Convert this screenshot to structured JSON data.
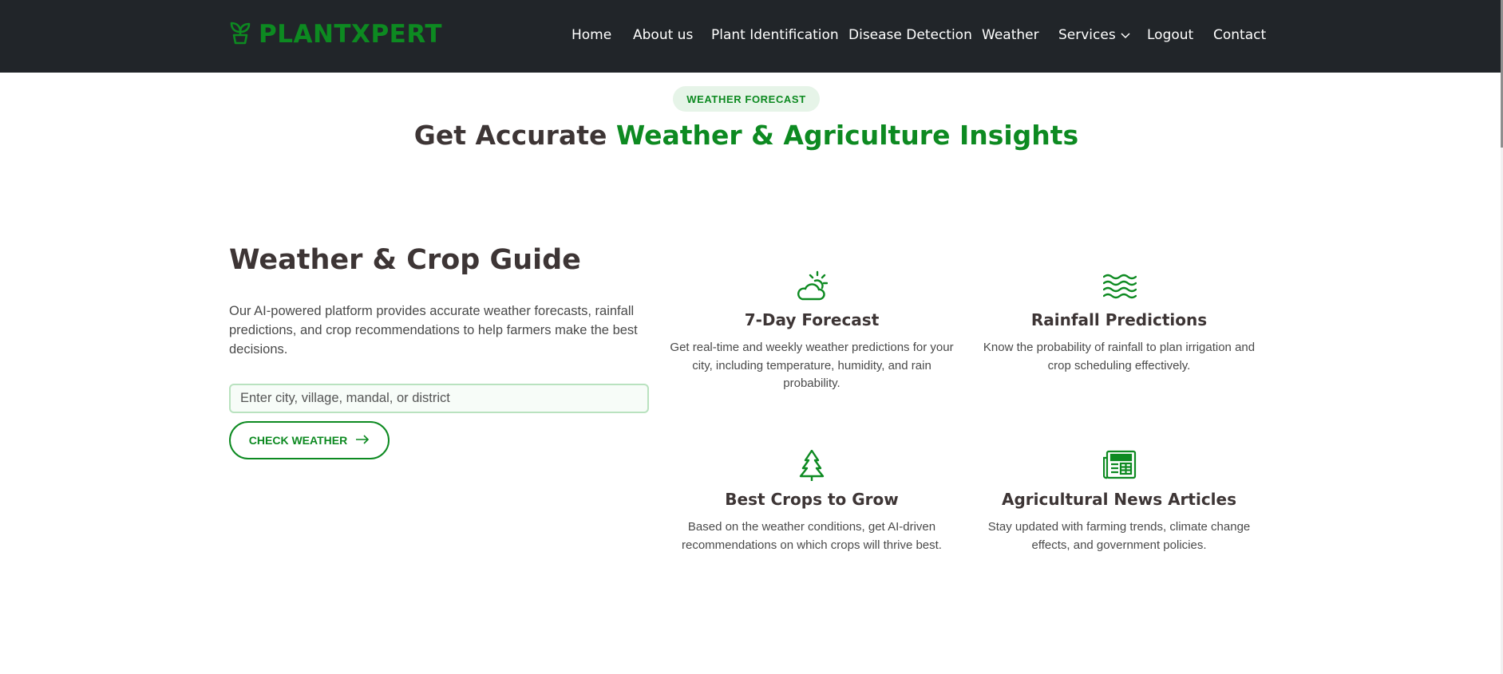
{
  "brand": {
    "name": "PLANTXPERT",
    "color": "#0d8a21"
  },
  "nav": {
    "items": [
      {
        "label": "Home"
      },
      {
        "label": "About us"
      },
      {
        "label": "Plant Identification"
      },
      {
        "label": "Disease Detection"
      },
      {
        "label": "Weather"
      },
      {
        "label": "Services",
        "icon": "chevron-down-icon"
      },
      {
        "label": "Logout"
      },
      {
        "label": "Contact"
      }
    ]
  },
  "section": {
    "badge": "WEATHER FORECAST",
    "title_plain": "Get Accurate ",
    "title_accent": "Weather & Agriculture Insights"
  },
  "guide": {
    "title": "Weather & Crop Guide",
    "description": "Our AI-powered platform provides accurate weather forecasts, rainfall predictions, and crop recommendations to help farmers make the best decisions.",
    "search_placeholder": "Enter city, village, mandal, or district",
    "button_label": "CHECK WEATHER",
    "button_icon": "arrow-right-icon"
  },
  "features": [
    {
      "icon": "cloud-sun-icon",
      "title": "7-Day Forecast",
      "description": "Get real-time and weekly weather predictions for your city, including temperature, humidity, and rain probability."
    },
    {
      "icon": "water-waves-icon",
      "title": "Rainfall Predictions",
      "description": "Know the probability of rainfall to plan irrigation and crop scheduling effectively."
    },
    {
      "icon": "tree-icon",
      "title": "Best Crops to Grow",
      "description": "Based on the weather conditions, get AI-driven recommendations on which crops will thrive best."
    },
    {
      "icon": "newspaper-icon",
      "title": "Agricultural News Articles",
      "description": "Stay updated with farming trends, climate change effects, and government policies."
    }
  ],
  "colors": {
    "header_bg": "#212529",
    "accent": "#0d8a21",
    "text": "#3d3535"
  }
}
